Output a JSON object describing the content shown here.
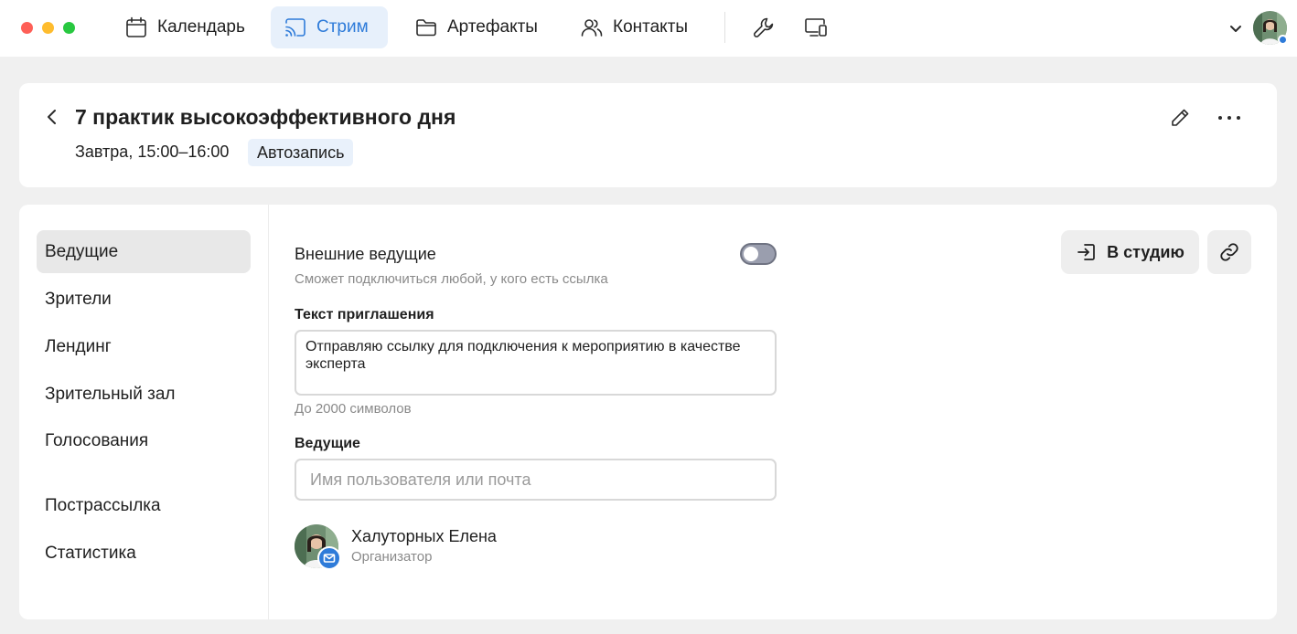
{
  "topbar": {
    "tabs": [
      {
        "label": "Календарь",
        "icon": "calendar-icon",
        "active": false
      },
      {
        "label": "Стрим",
        "icon": "cast-icon",
        "active": true
      },
      {
        "label": "Артефакты",
        "icon": "folder-icon",
        "active": false
      },
      {
        "label": "Контакты",
        "icon": "users-icon",
        "active": false
      }
    ],
    "tools": [
      "wrench-icon",
      "devices-icon"
    ],
    "accent_color": "#2e7bd9"
  },
  "event": {
    "title": "7 практик высокоэффективного дня",
    "time": "Завтра, 15:00–16:00",
    "badge": "Автозапись"
  },
  "sidebar": {
    "items": [
      {
        "label": "Ведущие",
        "active": true
      },
      {
        "label": "Зрители",
        "active": false
      },
      {
        "label": "Лендинг",
        "active": false
      },
      {
        "label": "Зрительный зал",
        "active": false
      },
      {
        "label": "Голосования",
        "active": false
      },
      {
        "label": "Пострассылка",
        "active": false
      },
      {
        "label": "Статистика",
        "active": false
      }
    ]
  },
  "hosts": {
    "external_toggle": {
      "title": "Внешние ведущие",
      "hint": "Сможет подключиться любой, у кого есть ссылка",
      "enabled": false
    },
    "invitation": {
      "label": "Текст приглашения",
      "value": "Отправляю ссылку для подключения к мероприятию в качестве эксперта",
      "hint": "До 2000 символов"
    },
    "hosts_field": {
      "label": "Ведущие",
      "placeholder": "Имя пользователя или почта"
    },
    "list": [
      {
        "name": "Халуторных Елена",
        "role": "Организатор"
      }
    ],
    "studio_button": "В студию"
  }
}
